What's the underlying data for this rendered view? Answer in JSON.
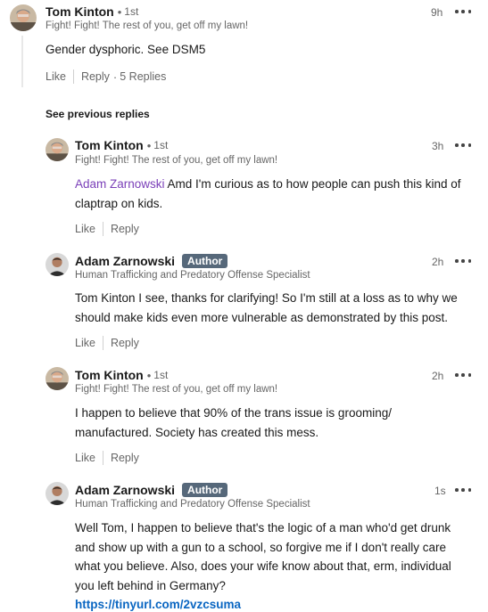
{
  "see_previous_label": "See previous replies",
  "comments": [
    {
      "name": "Tom Kinton",
      "degree": "1st",
      "headline": "Fight! Fight! The rest of you, get off my lawn!",
      "time": "9h",
      "body": "Gender dysphoric. See DSM5",
      "like_label": "Like",
      "reply_label": "Reply",
      "replies_label": "5 Replies"
    },
    {
      "name": "Tom Kinton",
      "degree": "1st",
      "headline": "Fight! Fight! The rest of you, get off my lawn!",
      "time": "3h",
      "mention": "Adam Zarnowski",
      "body_line1": " Amd I'm curious as to how people can push this kind of",
      "body_line2": "claptrap on kids.",
      "like_label": "Like",
      "reply_label": "Reply"
    },
    {
      "name": "Adam Zarnowski",
      "badge": "Author",
      "headline": "Human Trafficking and Predatory Offense Specialist",
      "time": "2h",
      "body_line1": "Tom Kinton I see, thanks for clarifying! So I'm still at a loss as to why we",
      "body_line2": "should make kids even more vulnerable as demonstrated by this post.",
      "like_label": "Like",
      "reply_label": "Reply"
    },
    {
      "name": "Tom Kinton",
      "degree": "1st",
      "headline": "Fight! Fight! The rest of you, get off my lawn!",
      "time": "2h",
      "body_line1": "I happen to believe that 90% of the trans issue is grooming/",
      "body_line2": "manufactured. Society has created this mess.",
      "like_label": "Like",
      "reply_label": "Reply"
    },
    {
      "name": "Adam Zarnowski",
      "badge": "Author",
      "headline": "Human Trafficking and Predatory Offense Specialist",
      "time": "1s",
      "body_line1": "Well Tom, I happen to believe that's the logic of a man who'd get drunk",
      "body_line2": "and show up with a gun to a school, so forgive me if I don't really care",
      "body_line3": "what you believe. Also, does your wife know about that, erm, individual",
      "body_line4": "you left behind in Germany?",
      "link": "https://tinyurl.com/2vzcsuma"
    }
  ],
  "colors": {
    "badge_bg": "#56687a",
    "mention": "#7a3fb8",
    "link": "#0a66c2",
    "secondary_text": "#666666"
  }
}
